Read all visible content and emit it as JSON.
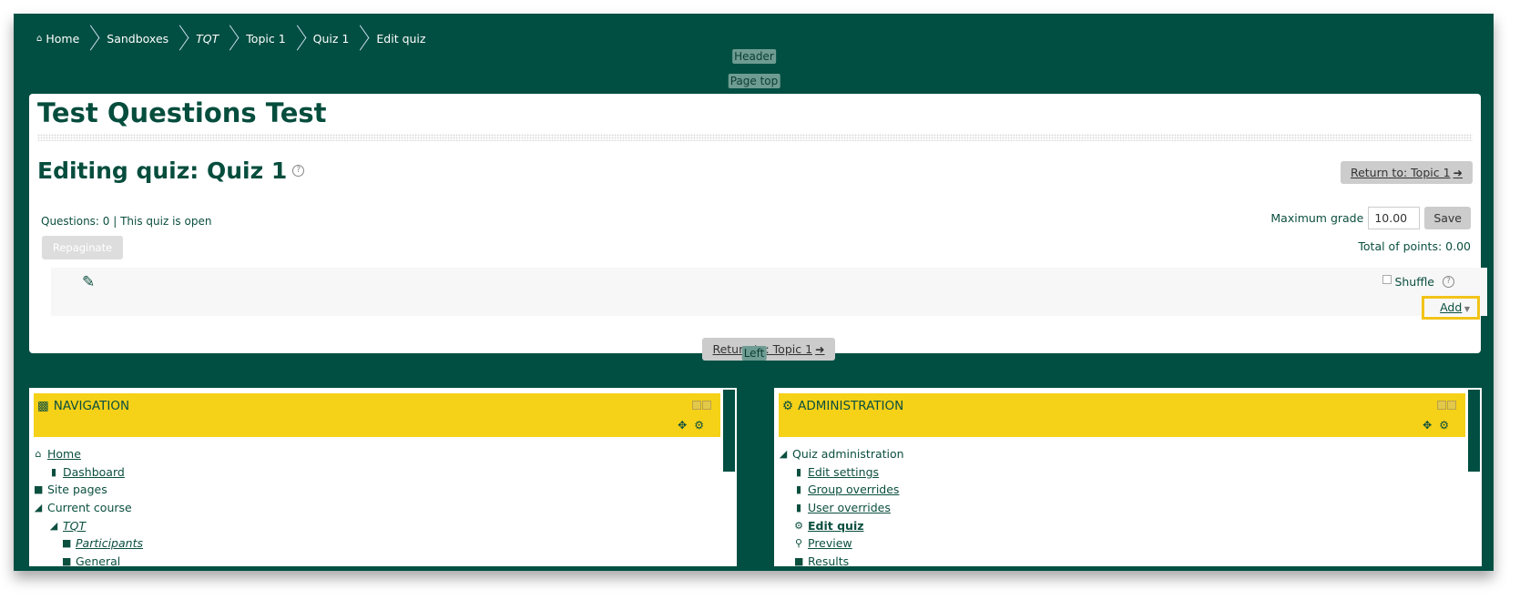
{
  "breadcrumb": [
    {
      "label": "Home",
      "icon": "home-icon"
    },
    {
      "label": "Sandboxes"
    },
    {
      "label": "TQT",
      "italic": true
    },
    {
      "label": "Topic 1"
    },
    {
      "label": "Quiz 1"
    },
    {
      "label": "Edit quiz"
    }
  ],
  "regions": {
    "header": "Header",
    "page_top": "Page top",
    "left": "Left"
  },
  "page": {
    "title": "Test Questions Test",
    "heading": "Editing quiz: Quiz 1",
    "return_label": "Return to: Topic 1",
    "info": "Questions: 0 | This quiz is open",
    "repaginate": "Repaginate",
    "max_grade_label": "Maximum grade",
    "max_grade_value": "10.00",
    "save": "Save",
    "total": "Total of points: 0.00",
    "shuffle": "Shuffle",
    "add": "Add"
  },
  "navigation": {
    "title": "NAVIGATION",
    "items": [
      {
        "label": "Home",
        "link": true
      },
      {
        "label": "Dashboard",
        "link": true
      },
      {
        "label": "Site pages"
      },
      {
        "label": "Current course"
      },
      {
        "label": "TQT",
        "link": true
      },
      {
        "label": "Participants",
        "link": true
      },
      {
        "label": "General"
      }
    ]
  },
  "administration": {
    "title": "ADMINISTRATION",
    "items": [
      {
        "label": "Quiz administration"
      },
      {
        "label": "Edit settings"
      },
      {
        "label": "Group overrides"
      },
      {
        "label": "User overrides"
      },
      {
        "label": "Edit quiz"
      },
      {
        "label": "Preview"
      },
      {
        "label": "Results"
      }
    ]
  },
  "colors": {
    "brand": "#004f42",
    "block_header": "#f5d117",
    "highlight": "#f2c318"
  }
}
